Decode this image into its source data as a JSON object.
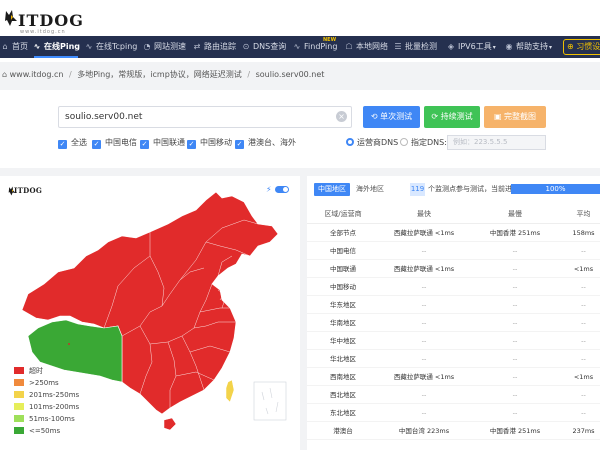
{
  "header": {
    "logo_text": "ITDOG",
    "logo_subtitle": "www.itdog.cn",
    "nav": [
      {
        "label": "首页",
        "icon": "home-icon"
      },
      {
        "label": "在线Ping",
        "icon": "pulse-icon",
        "active": true
      },
      {
        "label": "在线Tcping",
        "icon": "pulse-icon"
      },
      {
        "label": "网站测速",
        "icon": "speed-icon"
      },
      {
        "label": "路由追踪",
        "icon": "route-icon"
      },
      {
        "label": "DNS查询",
        "icon": "dns-icon"
      },
      {
        "label": "FindPing",
        "icon": "pulse-icon"
      },
      {
        "label": "本地网络",
        "icon": "network-icon"
      },
      {
        "label": "批量检测",
        "icon": "list-icon"
      },
      {
        "label": "IPV6工具",
        "icon": "ipv6-icon"
      },
      {
        "label": "帮助支持",
        "icon": "help-icon"
      }
    ],
    "new_badge": "NEW",
    "habit_button": "习惯设置"
  },
  "breadcrumb": {
    "items": [
      "www.itdog.cn",
      "多地Ping，常规版，icmp协议，网络延迟测试",
      "soulio.serv00.net"
    ],
    "separator": "/"
  },
  "controls": {
    "url_value": "soulio.serv00.net",
    "buttons": {
      "single": "单次测试",
      "continuous": "持续测试",
      "screenshot": "完整截图"
    },
    "checkboxes": [
      "全选",
      "中国电信",
      "中国联通",
      "中国移动",
      "港澳台、海外"
    ],
    "dns_options": {
      "operator": "运营商DNS",
      "custom": "指定DNS:"
    },
    "dns_placeholder": "例如：223.5.5.5"
  },
  "map": {
    "mini_logo": "ITDOG",
    "legend": [
      {
        "label": "超时",
        "color": "#e12b2b"
      },
      {
        "label": ">250ms",
        "color": "#f08a3c"
      },
      {
        "label": "201ms-250ms",
        "color": "#f3d34a"
      },
      {
        "label": "101ms-200ms",
        "color": "#e6ee5a"
      },
      {
        "label": "51ms-100ms",
        "color": "#9ee05a"
      },
      {
        "label": "<=50ms",
        "color": "#3aa835"
      }
    ],
    "colors": {
      "timeout": "#e12b2b",
      "fast": "#3aa835",
      "medium": "#f3d34a"
    }
  },
  "results": {
    "tabs": {
      "china": "中国地区",
      "overseas": "海外地区"
    },
    "node_count": "119",
    "node_text": "个监测点参与测试，当前进度:",
    "progress": 100,
    "progress_label": "100%",
    "columns": [
      "区域/运营商",
      "最快",
      "最慢",
      "平均"
    ],
    "rows": [
      {
        "region": "全部节点",
        "fastest": "西藏拉萨联通 <1ms",
        "slowest": "中国香港 251ms",
        "avg": "158ms"
      },
      {
        "region": "中国电信",
        "fastest": "--",
        "slowest": "--",
        "avg": "--"
      },
      {
        "region": "中国联通",
        "fastest": "西藏拉萨联通 <1ms",
        "slowest": "--",
        "avg": "<1ms"
      },
      {
        "region": "中国移动",
        "fastest": "--",
        "slowest": "--",
        "avg": "--"
      },
      {
        "region": "华东地区",
        "fastest": "--",
        "slowest": "--",
        "avg": "--"
      },
      {
        "region": "华南地区",
        "fastest": "--",
        "slowest": "--",
        "avg": "--"
      },
      {
        "region": "华中地区",
        "fastest": "--",
        "slowest": "--",
        "avg": "--"
      },
      {
        "region": "华北地区",
        "fastest": "--",
        "slowest": "--",
        "avg": "--"
      },
      {
        "region": "西南地区",
        "fastest": "西藏拉萨联通 <1ms",
        "slowest": "--",
        "avg": "<1ms"
      },
      {
        "region": "西北地区",
        "fastest": "--",
        "slowest": "--",
        "avg": "--"
      },
      {
        "region": "东北地区",
        "fastest": "--",
        "slowest": "--",
        "avg": "--"
      },
      {
        "region": "港澳台",
        "fastest": "中国台湾 223ms",
        "slowest": "中国香港 251ms",
        "avg": "237ms"
      }
    ]
  }
}
